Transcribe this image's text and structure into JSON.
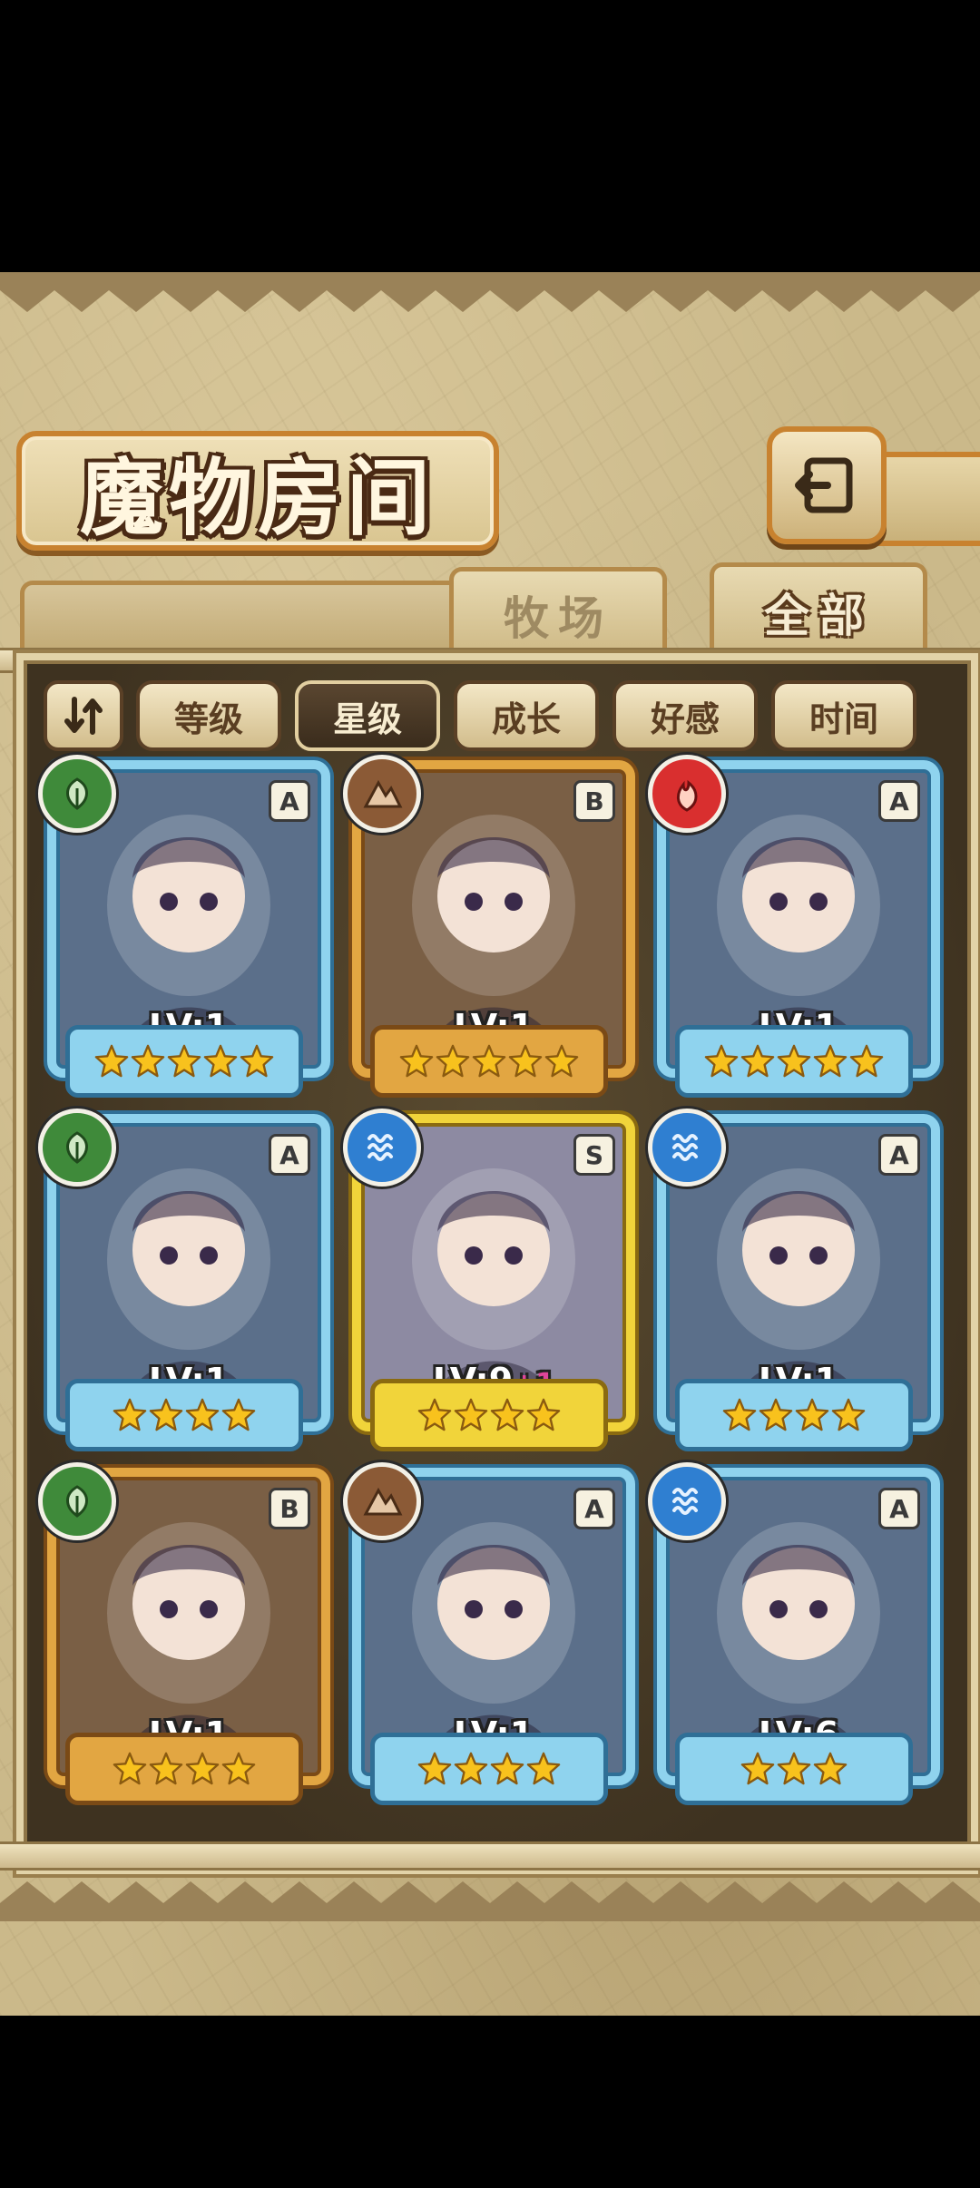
{
  "title": "魔物房间",
  "tabs": [
    {
      "label": "牧场",
      "active": false
    },
    {
      "label": "全部",
      "active": true
    }
  ],
  "sort_buttons": [
    {
      "label": "等级",
      "active": false
    },
    {
      "label": "星级",
      "active": true
    },
    {
      "label": "成长",
      "active": false
    },
    {
      "label": "好感",
      "active": false
    },
    {
      "label": "时间",
      "active": false
    }
  ],
  "colors": {
    "frame_blue": "#8fd3ee",
    "frame_gold": "#e2a642",
    "frame_yellow": "#f1d43a",
    "element_leaf": "#3f8a3a",
    "element_earth": "#8b5a36",
    "element_fire": "#d92f2f",
    "element_water": "#2f7fd1"
  },
  "monsters": [
    {
      "level_label": "LV:1",
      "level_bonus": "",
      "rank": "A",
      "element": "leaf",
      "frame": "blue",
      "stars": 5
    },
    {
      "level_label": "LV:1",
      "level_bonus": "",
      "rank": "B",
      "element": "earth",
      "frame": "gold",
      "stars": 5
    },
    {
      "level_label": "LV:1",
      "level_bonus": "",
      "rank": "A",
      "element": "fire",
      "frame": "blue",
      "stars": 5
    },
    {
      "level_label": "LV:1",
      "level_bonus": "",
      "rank": "A",
      "element": "leaf",
      "frame": "blue",
      "stars": 4
    },
    {
      "level_label": "LV:9",
      "level_bonus": "+1",
      "rank": "S",
      "element": "water",
      "frame": "yellow",
      "stars": 4
    },
    {
      "level_label": "LV:1",
      "level_bonus": "",
      "rank": "A",
      "element": "water",
      "frame": "blue",
      "stars": 4
    },
    {
      "level_label": "LV:1",
      "level_bonus": "",
      "rank": "B",
      "element": "leaf",
      "frame": "gold",
      "stars": 4
    },
    {
      "level_label": "LV:1",
      "level_bonus": "",
      "rank": "A",
      "element": "earth",
      "frame": "blue",
      "stars": 4
    },
    {
      "level_label": "LV:6",
      "level_bonus": "",
      "rank": "A",
      "element": "water",
      "frame": "blue",
      "stars": 3
    }
  ]
}
